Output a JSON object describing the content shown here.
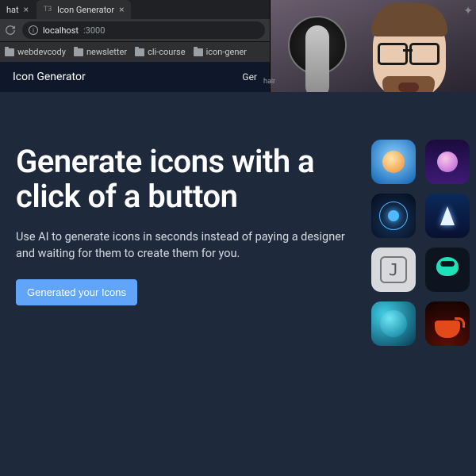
{
  "browser": {
    "tabs": [
      {
        "title": "hat",
        "active": false
      },
      {
        "title": "Icon Generator",
        "active": true,
        "favicon": "T3"
      }
    ],
    "url_host": "localhost",
    "url_port": ":3000",
    "reload_icon": "reload",
    "info_label": "i",
    "bookmarks": [
      "webdevcody",
      "newsletter",
      "cli-course",
      "icon-gener"
    ]
  },
  "app": {
    "brand": "Icon Generator",
    "nav": {
      "item1": "Ger"
    },
    "hair_text": "hair"
  },
  "hero": {
    "headline": "Generate icons with a click of a button",
    "sub": "Use AI to generate icons in seconds instead of paying a designer and waiting for them to create them for you.",
    "cta": "Generated your Icons"
  },
  "icons": [
    "avatar-orange",
    "avatar-purple",
    "planet",
    "rocket",
    "letter-j",
    "ninja",
    "sphere-teal",
    "coffee-cup"
  ]
}
